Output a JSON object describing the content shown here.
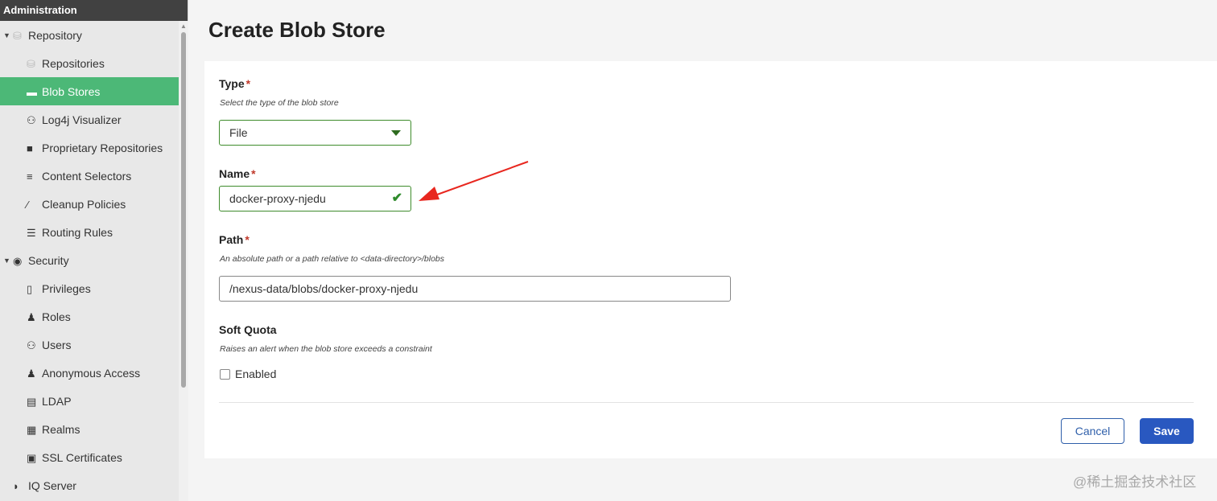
{
  "sidebar": {
    "header": "Administration",
    "items": [
      {
        "label": "Repository",
        "icon": "database-icon",
        "glyph": "⛁",
        "level": "group"
      },
      {
        "label": "Repositories",
        "icon": "database-icon",
        "glyph": "⛁",
        "level": "child"
      },
      {
        "label": "Blob Stores",
        "icon": "hard-drive-icon",
        "glyph": "▬",
        "level": "child",
        "active": true
      },
      {
        "label": "Log4j Visualizer",
        "icon": "binoculars-icon",
        "glyph": "⚇",
        "level": "child"
      },
      {
        "label": "Proprietary Repositories",
        "icon": "book-icon",
        "glyph": "■",
        "level": "child"
      },
      {
        "label": "Content Selectors",
        "icon": "layers-icon",
        "glyph": "≡",
        "level": "child"
      },
      {
        "label": "Cleanup Policies",
        "icon": "broom-icon",
        "glyph": "⁄",
        "level": "child"
      },
      {
        "label": "Routing Rules",
        "icon": "signpost-icon",
        "glyph": "☰",
        "level": "child"
      },
      {
        "label": "Security",
        "icon": "eye-icon",
        "glyph": "◉",
        "level": "group"
      },
      {
        "label": "Privileges",
        "icon": "badge-icon",
        "glyph": "▯",
        "level": "child"
      },
      {
        "label": "Roles",
        "icon": "user-gear-icon",
        "glyph": "♟",
        "level": "child"
      },
      {
        "label": "Users",
        "icon": "users-icon",
        "glyph": "⚇",
        "level": "child"
      },
      {
        "label": "Anonymous Access",
        "icon": "user-icon",
        "glyph": "♟",
        "level": "child"
      },
      {
        "label": "LDAP",
        "icon": "book-icon",
        "glyph": "▤",
        "level": "child"
      },
      {
        "label": "Realms",
        "icon": "building-icon",
        "glyph": "▦",
        "level": "child"
      },
      {
        "label": "SSL Certificates",
        "icon": "id-card-icon",
        "glyph": "▣",
        "level": "child"
      },
      {
        "label": "IQ Server",
        "icon": "shield-icon",
        "glyph": "◗",
        "level": "group"
      }
    ]
  },
  "page": {
    "title": "Create Blob Store"
  },
  "form": {
    "type": {
      "label": "Type",
      "required": "*",
      "help": "Select the type of the blob store",
      "value": "File"
    },
    "name": {
      "label": "Name",
      "required": "*",
      "value": "docker-proxy-njedu"
    },
    "path": {
      "label": "Path",
      "required": "*",
      "help": "An absolute path or a path relative to <data-directory>/blobs",
      "value": "/nexus-data/blobs/docker-proxy-njedu"
    },
    "soft_quota": {
      "label": "Soft Quota",
      "help": "Raises an alert when the blob store exceeds a constraint",
      "checkbox_label": "Enabled",
      "checked": false
    }
  },
  "buttons": {
    "cancel": "Cancel",
    "save": "Save"
  },
  "colors": {
    "accent": "#4cb877",
    "primary": "#2958c0",
    "valid": "#3e8b2b",
    "annotation": "#e8271f"
  },
  "watermark": "@稀土掘金技术社区"
}
